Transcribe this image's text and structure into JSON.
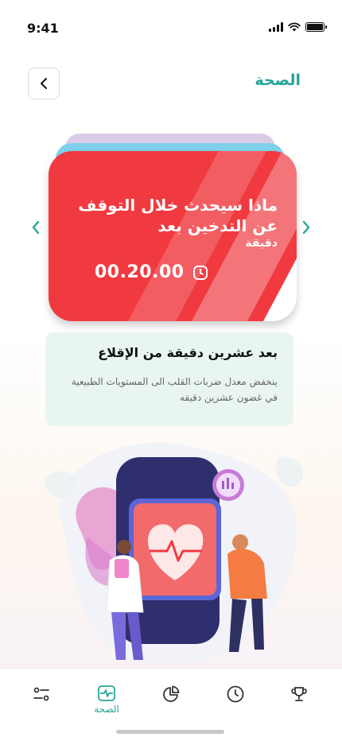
{
  "status_bar": {
    "time": "9:41"
  },
  "header": {
    "title": "الصحة"
  },
  "card": {
    "title": "ماذا سيحدث خلال التوقف عن التدخين بعد",
    "unit": "دقيقة",
    "timer": "00.20.00"
  },
  "info": {
    "title": "بعد عشرين دقيقة من الإقلاع",
    "body": "ينخفض معدل ضربات القلب الى المستويات الطبيعية في غضون عشرين دقيقه"
  },
  "nav": {
    "items": [
      {
        "icon": "trophy-icon",
        "label": ""
      },
      {
        "icon": "clock-icon",
        "label": ""
      },
      {
        "icon": "pie-chart-icon",
        "label": ""
      },
      {
        "icon": "health-icon",
        "label": "الصحة",
        "active": true
      },
      {
        "icon": "settings-sliders-icon",
        "label": ""
      }
    ]
  },
  "colors": {
    "accent": "#27a59a",
    "card_red": "#f03a40",
    "info_bg": "#e9f5f1"
  }
}
